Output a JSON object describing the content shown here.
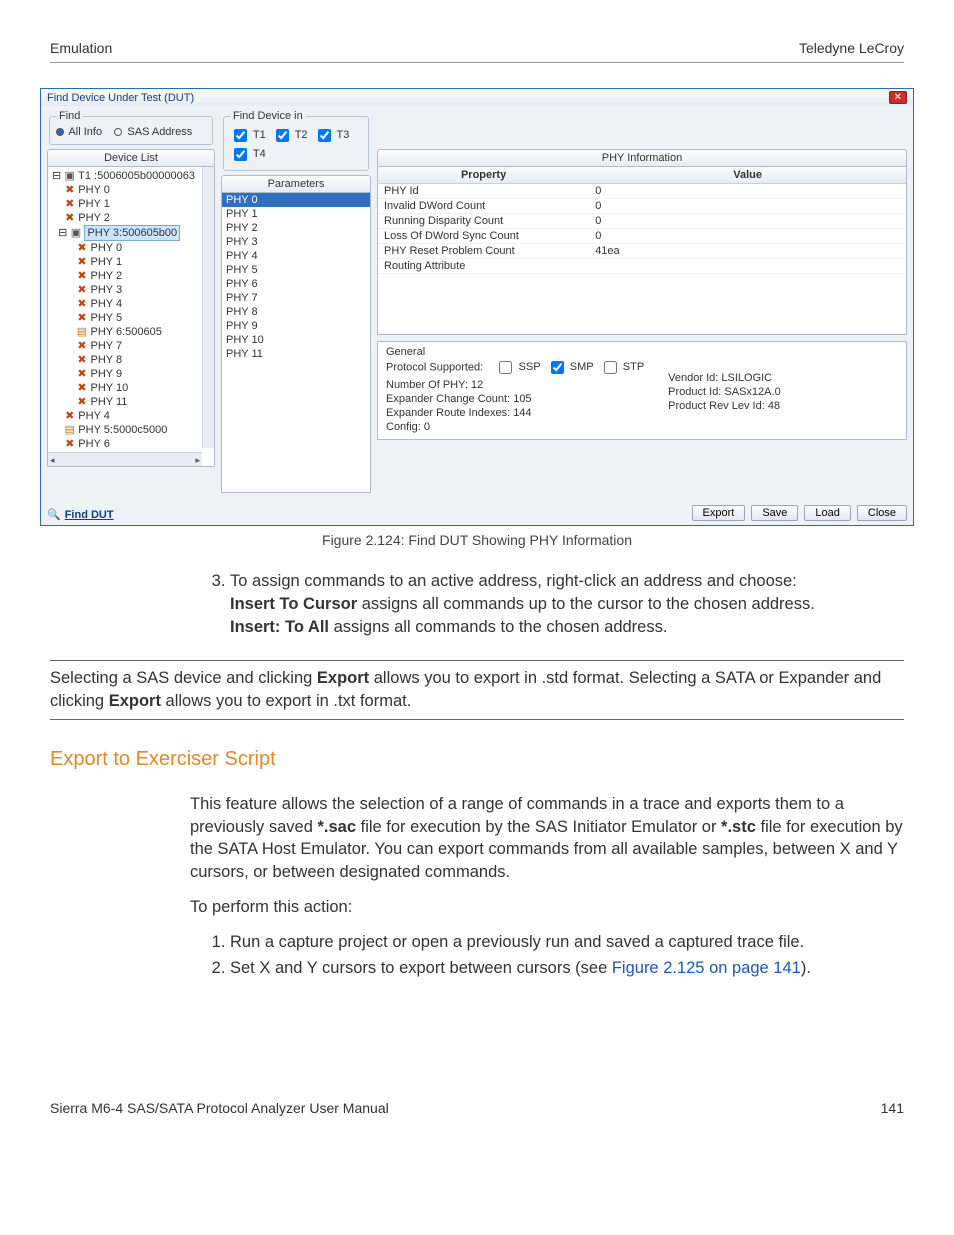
{
  "header": {
    "left": "Emulation",
    "right": "Teledyne LeCroy"
  },
  "dialog": {
    "title": "Find Device Under Test (DUT)",
    "find": {
      "legend": "Find",
      "all_info": "All Info",
      "sas_addr": "SAS Address"
    },
    "find_in": {
      "legend": "Find Device in",
      "t1": "T1",
      "t2": "T2",
      "t3": "T3",
      "t4": "T4"
    },
    "tabs": {
      "device_list": "Device List",
      "parameters": "Parameters",
      "phy_info": "PHY Information"
    },
    "tree": {
      "root1": "T1 :5006005b00000063",
      "l1": [
        "PHY 0",
        "PHY 1",
        "PHY 2"
      ],
      "root2": "PHY 3:500605b00",
      "l2": [
        "PHY 0",
        "PHY 1",
        "PHY 2",
        "PHY 3",
        "PHY 4",
        "PHY 5",
        "PHY 6:500605",
        "PHY 7",
        "PHY 8",
        "PHY 9",
        "PHY 10",
        "PHY 11"
      ],
      "l3": [
        "PHY 4",
        "PHY 5:5000c5000",
        "PHY 6"
      ]
    },
    "params": [
      "PHY 0",
      "PHY 1",
      "PHY 2",
      "PHY 3",
      "PHY 4",
      "PHY 5",
      "PHY 6",
      "PHY 7",
      "PHY 8",
      "PHY 9",
      "PHY 10",
      "PHY 11"
    ],
    "phy_table": {
      "header_prop": "Property",
      "header_val": "Value",
      "rows": [
        {
          "p": "PHY Id",
          "v": "0"
        },
        {
          "p": "Invalid DWord Count",
          "v": "0"
        },
        {
          "p": "Running Disparity Count",
          "v": "0"
        },
        {
          "p": "Loss Of DWord Sync Count",
          "v": "0"
        },
        {
          "p": "PHY Reset Problem Count",
          "v": "41ea"
        },
        {
          "p": "Routing Attribute",
          "v": ""
        }
      ]
    },
    "general": {
      "legend": "General",
      "proto_label": "Protocol Supported:",
      "ssp": "SSP",
      "smp": "SMP",
      "stp": "STP",
      "num_phy": "Number Of PHY: 12",
      "exp_change": "Expander Change Count: 105",
      "exp_route": "Expander Route Indexes: 144",
      "config": "Config: 0",
      "vendor": "Vendor Id: LSILOGIC",
      "product": "Product Id: SASx12A.0",
      "rev": "Product Rev Lev Id: 48"
    },
    "find_dut": "Find DUT",
    "buttons": {
      "export": "Export",
      "save": "Save",
      "load": "Load",
      "close": "Close"
    }
  },
  "figure_caption": "Figure 2.124: Find DUT Showing PHY Information",
  "step3": {
    "lead": "To assign commands to an active address, right-click an address and choose:",
    "l1a": "Insert To Cursor",
    "l1b": " assigns all commands up to the cursor to the chosen address.",
    "l2a": "Insert: To All",
    "l2b": " assigns all commands to the chosen address."
  },
  "note": {
    "p1a": "Selecting a SAS device and clicking ",
    "p1b": "Export",
    "p1c": " allows you to export in .std format. Selecting a SATA or Expander and clicking ",
    "p1d": "Export",
    "p1e": " allows you to export in .txt format."
  },
  "section_heading": "Export to Exerciser Script",
  "para1a": "This feature allows the selection of a range of commands in a trace and exports them to a previously saved ",
  "para1b": "*.sac",
  "para1c": " file for execution by the SAS Initiator Emulator or ",
  "para1d": "*.stc",
  "para1e": " file for execution by the SATA Host Emulator. You can export commands from all available samples, between X and Y cursors, or between designated commands.",
  "para2": "To perform this action:",
  "steps": {
    "s1": "Run a capture project or open a previously run and saved a captured trace file.",
    "s2a": "Set X and Y cursors to export between cursors (see ",
    "s2b": "Figure 2.125 on page 141",
    "s2c": ")."
  },
  "footer": {
    "left": "Sierra M6-4 SAS/SATA Protocol Analyzer User Manual",
    "right": "141"
  }
}
